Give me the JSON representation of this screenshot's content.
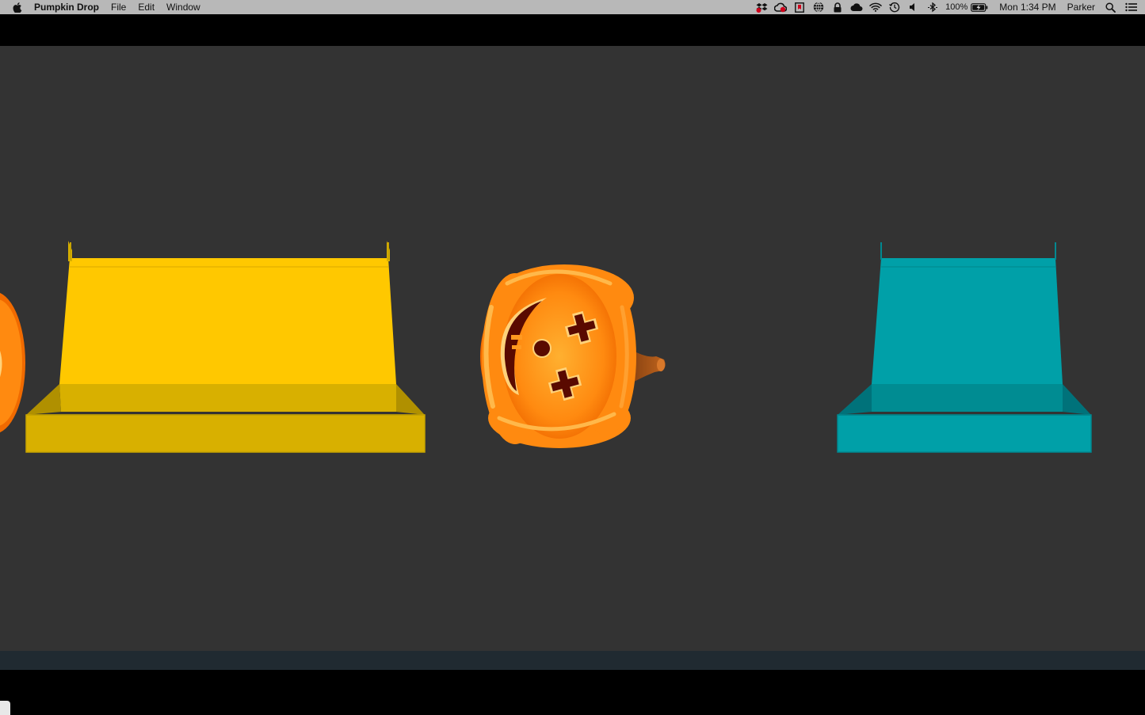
{
  "menubar": {
    "app_name": "Pumpkin Drop",
    "menus": [
      "File",
      "Edit",
      "Window"
    ],
    "status_icons": [
      "dropbox-icon",
      "creative-cloud-icon",
      "bookmark-app-icon",
      "globe-icon",
      "lock-icon",
      "cloud-app-icon",
      "wifi-icon",
      "time-machine-icon",
      "volume-icon",
      "bluetooth-icon"
    ],
    "battery_percent": "100%",
    "clock": "Mon 1:34 PM",
    "user": "Parker"
  },
  "game": {
    "pumpkin_face": "x-eyes",
    "bins": [
      {
        "id": "yellow-bin",
        "color": "#ffc800",
        "shade": "#d8b000"
      },
      {
        "id": "teal-bin",
        "color": "#00a0a8",
        "shade": "#008c92"
      }
    ],
    "colors": {
      "background": "#333333",
      "pumpkin": "#ff8a10"
    }
  }
}
